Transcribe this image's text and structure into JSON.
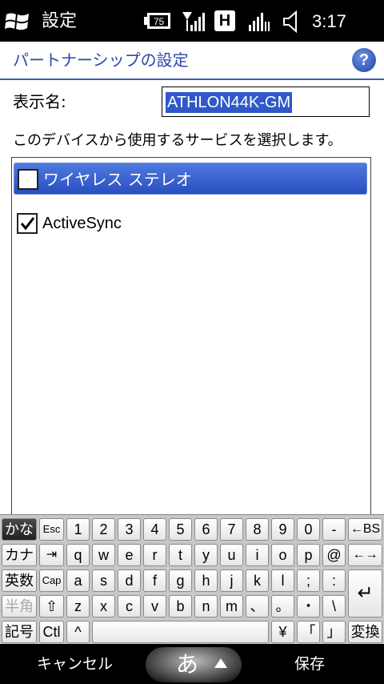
{
  "status_bar": {
    "title": "設定",
    "battery_level": "75",
    "network_indicator": "H",
    "time": "3:17"
  },
  "header": {
    "title": "パートナーシップの設定",
    "help_label": "?"
  },
  "form": {
    "name_label": "表示名:",
    "name_value": "ATHLON44K-GM",
    "select_text": "このデバイスから使用するサービスを選択します。"
  },
  "services": [
    {
      "label": "ワイヤレス ステレオ",
      "checked": false,
      "selected": true
    },
    {
      "label": "ActiveSync",
      "checked": true,
      "selected": false
    }
  ],
  "keyboard": {
    "row1": [
      "かな",
      "Esc",
      "1",
      "2",
      "3",
      "4",
      "5",
      "6",
      "7",
      "8",
      "9",
      "0",
      "-",
      "←BS"
    ],
    "row2": [
      "カナ",
      "⇥",
      "q",
      "w",
      "e",
      "r",
      "t",
      "y",
      "u",
      "i",
      "o",
      "p",
      "@",
      "←→"
    ],
    "row3": [
      "英数",
      "Cap",
      "a",
      "s",
      "d",
      "f",
      "g",
      "h",
      "j",
      "k",
      "l",
      ";",
      ":"
    ],
    "row4": [
      "半角",
      "⇧",
      "z",
      "x",
      "c",
      "v",
      "b",
      "n",
      "m",
      "、",
      "。",
      "・",
      "\\",
      "↵"
    ],
    "row5": [
      "記号",
      "Ctl",
      "^",
      "",
      "¥",
      "「",
      "」",
      "変換"
    ]
  },
  "softkeys": {
    "left": "キャンセル",
    "ime": "あ",
    "right": "保存"
  },
  "colors": {
    "accent": "#2b4aa8",
    "selection": "#3158c9"
  }
}
